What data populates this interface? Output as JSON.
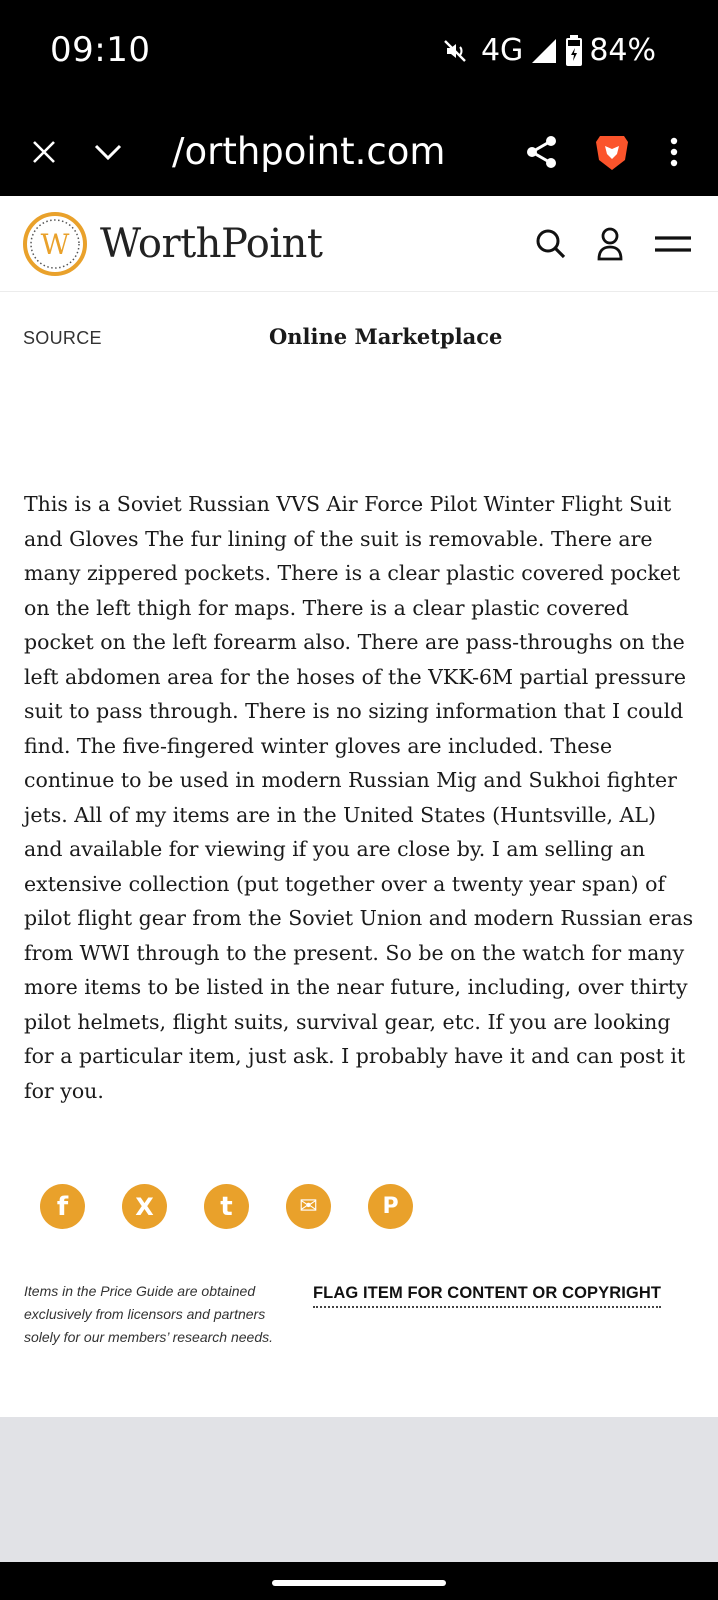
{
  "status_bar": {
    "time": "09:10",
    "network": "4G",
    "battery": "84%",
    "icons": [
      "mute-icon",
      "signal-icon",
      "battery-icon"
    ]
  },
  "browser": {
    "url": "∕orthpoint.com",
    "icons": [
      "close-icon",
      "chevron-down-icon",
      "share-icon",
      "brave-icon",
      "more-vert-icon"
    ]
  },
  "header": {
    "logo_letter": "W",
    "logo_text": "WorthPoint",
    "icons": [
      "search-icon",
      "user-icon",
      "menu-icon"
    ]
  },
  "details": {
    "source_label": "SOURCE",
    "source_value": "Online Marketplace"
  },
  "description": "This is a Soviet Russian VVS Air Force Pilot Winter Flight Suit and Gloves The fur lining of the suit is removable. There are many zippered pockets. There is a clear plastic covered pocket on the left thigh for maps. There is a clear plastic covered pocket on the left forearm also. There are pass-throughs on the left abdomen area for the hoses of the VKK-6M partial pressure suit to pass through. There is no sizing information that I could find. The five-fingered winter gloves are included. These continue to be used in modern Russian Mig and Sukhoi fighter jets. All of my items are in the United States (Huntsville, AL) and available for viewing if you are close by. I am selling an extensive collection (put together over a twenty year span) of pilot flight gear from the Soviet Union and modern Russian eras from WWI through to the present. So be on the watch for many more items to be listed in the near future, including, over thirty pilot helmets, flight suits, survival gear, etc. If you are looking for a particular item, just ask. I probably have it and can post it for you.",
  "social": {
    "buttons": [
      {
        "name": "facebook-icon",
        "glyph": "f"
      },
      {
        "name": "x-twitter-icon",
        "glyph": "X"
      },
      {
        "name": "tumblr-icon",
        "glyph": "t"
      },
      {
        "name": "email-icon",
        "glyph": "✉"
      },
      {
        "name": "pinterest-icon",
        "glyph": "P"
      }
    ],
    "color": "#e9a12b"
  },
  "footer": {
    "disclaimer": "Items in the Price Guide are obtained exclusively from licensors and partners solely for our members’ research needs.",
    "flag_link": "FLAG ITEM FOR CONTENT OR COPYRIGHT"
  },
  "colors": {
    "accent": "#e9a12b",
    "brave": "#fb542b"
  }
}
